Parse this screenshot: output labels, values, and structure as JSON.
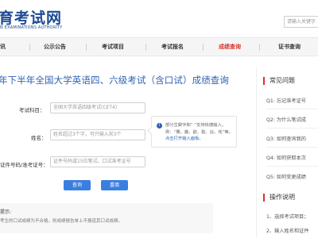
{
  "header": {
    "logo_title": "育考试网",
    "logo_subtitle": "N EXAMINATIONS AUTHORITY",
    "search_placeholder": "请输入关键字"
  },
  "nav": {
    "items": [
      {
        "label": "讯",
        "active": false
      },
      {
        "label": "公示公告",
        "active": false
      },
      {
        "label": "考试项目",
        "active": false
      },
      {
        "label": "考试报名",
        "active": false
      },
      {
        "label": "成绩查询",
        "active": true
      },
      {
        "label": "证书查询",
        "active": false
      }
    ]
  },
  "main": {
    "page_title": "年下半年全国大学英语四、六级考试（含口试）成绩查询",
    "form": {
      "subject_label": "考试科目：",
      "subject_value": "全国大学英语四级考试(CET4)",
      "name_label": "姓名：",
      "name_placeholder": "姓名超过3个字，可只输入前3个",
      "id_label": "证件号码/准考证号：",
      "id_placeholder": "证件号码或15位笔试、口试准考证号"
    },
    "tooltip": {
      "icon": "info-icon",
      "text": "部分生僻字和“·”支持快捷输入，例：“龑、鍇、叡、懿、惢、𠇔”等，",
      "link": "点击打开输入面板。"
    },
    "buttons": {
      "query": "查询",
      "reset": "重填"
    },
    "notice": {
      "title": "提示:",
      "text": "考生的口试成绩为不合格，则成绩报告单上不报道其口试成绩。"
    }
  },
  "sidebar": {
    "faq_title": "常见问题",
    "faq_items": [
      "Q1: 忘记准考证号",
      "Q2: 为什么笔试成",
      "Q3: 如何查询我的",
      "Q4: 如何获取本次",
      "Q5: 如何变更成绩"
    ],
    "guide_title": "操作说明",
    "guide_items": [
      "1、选择考试项目；",
      "2、输入姓名和证件"
    ]
  },
  "colors": {
    "brand_blue": "#1d4a93",
    "title_blue": "#2f62b4",
    "button_blue": "#3a7ee0",
    "accent_red": "#d9342b"
  }
}
